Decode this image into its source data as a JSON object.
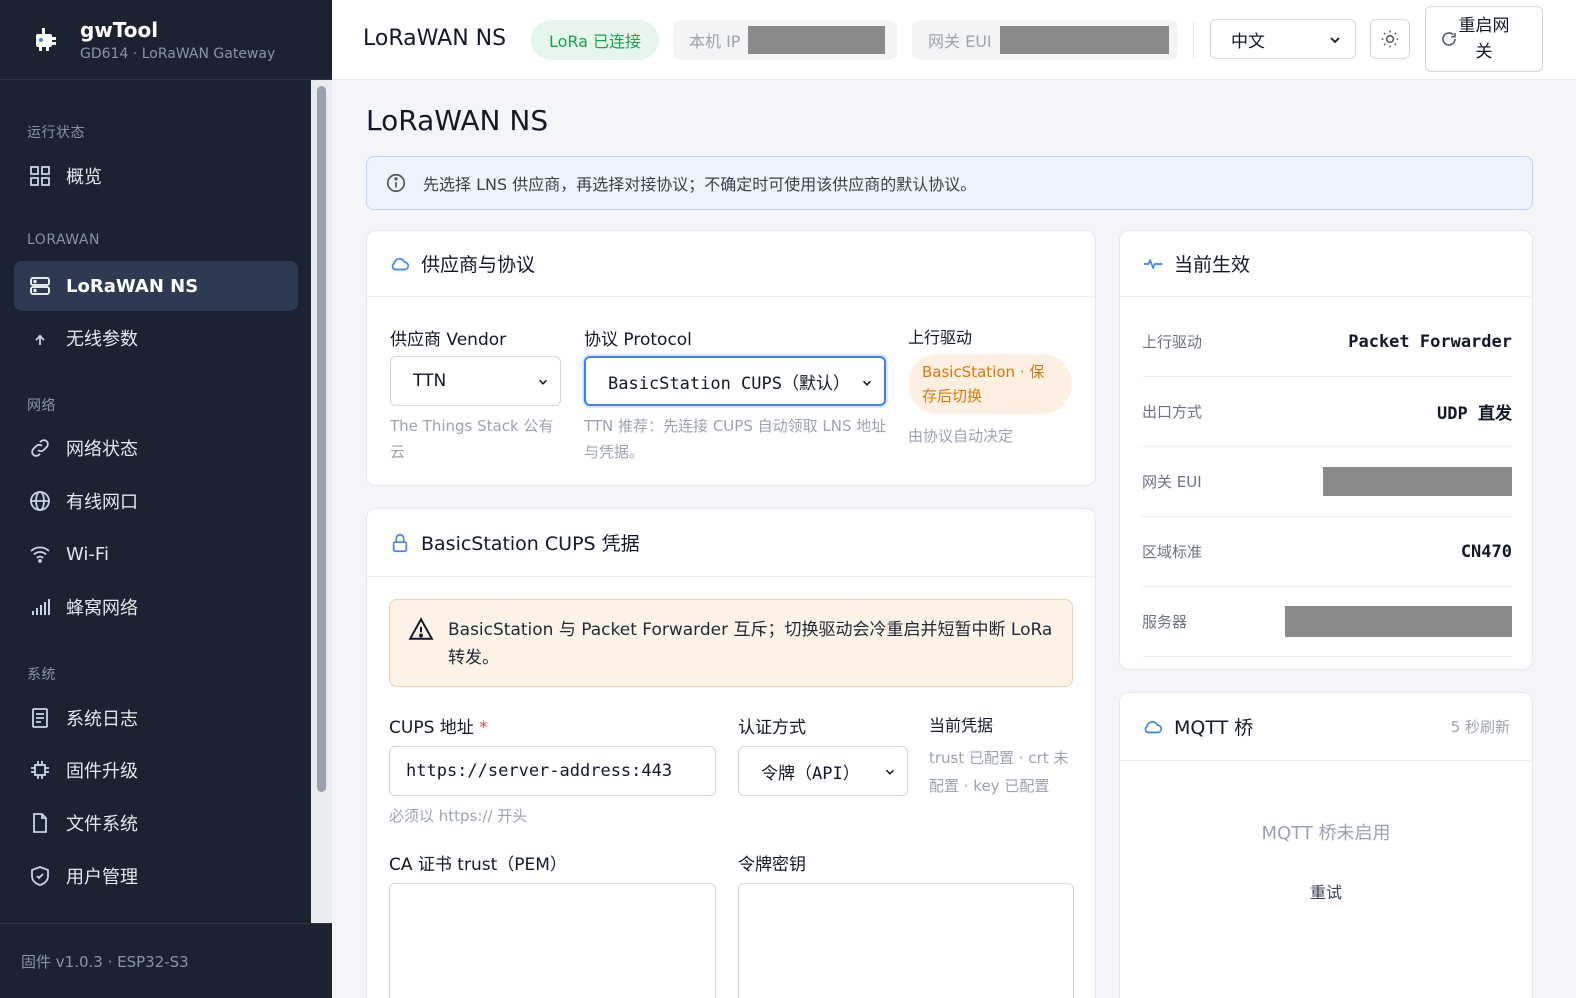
{
  "brand": {
    "title": "gwTool",
    "subtitle": "GD614 · LoRaWAN Gateway"
  },
  "sidebar": {
    "sections": [
      {
        "title": "运行状态"
      },
      {
        "title": "LORAWAN"
      },
      {
        "title": "网络"
      },
      {
        "title": "系统"
      }
    ],
    "items": [
      {
        "label": "概览",
        "icon": "grid-icon"
      },
      {
        "label": "LoRaWAN NS",
        "icon": "server-icon",
        "active": true
      },
      {
        "label": "无线参数",
        "icon": "antenna-icon"
      },
      {
        "label": "网络状态",
        "icon": "link-icon"
      },
      {
        "label": "有线网口",
        "icon": "globe-icon"
      },
      {
        "label": "Wi-Fi",
        "icon": "wifi-icon"
      },
      {
        "label": "蜂窝网络",
        "icon": "signal-icon"
      },
      {
        "label": "系统日志",
        "icon": "log-icon"
      },
      {
        "label": "固件升级",
        "icon": "chip-icon"
      },
      {
        "label": "文件系统",
        "icon": "file-icon"
      },
      {
        "label": "用户管理",
        "icon": "shield-icon"
      }
    ],
    "footer": "固件 v1.0.3 · ESP32-S3"
  },
  "header": {
    "title": "LoRaWAN NS",
    "lora_status": "LoRa 已连接",
    "local_ip_label": "本机 IP",
    "gateway_eui_label": "网关 EUI",
    "language": "中文",
    "reboot_label": "重启网关"
  },
  "main": {
    "title": "LoRaWAN NS",
    "info": "先选择 LNS 供应商，再选择对接协议；不确定时可使用该供应商的默认协议。",
    "vendor_card": {
      "title": "供应商与协议",
      "vendor_label": "供应商 Vendor",
      "vendor_value": "TTN",
      "vendor_hint": "The Things Stack 公有云",
      "protocol_label": "协议 Protocol",
      "protocol_value": "BasicStation CUPS（默认）",
      "protocol_hint": "TTN 推荐：先连接 CUPS 自动领取 LNS 地址与凭据。",
      "driver_label": "上行驱动",
      "driver_badge": "BasicStation · 保存后切换",
      "driver_hint": "由协议自动决定"
    },
    "cups_card": {
      "title": "BasicStation CUPS 凭据",
      "warning": "BasicStation 与 Packet Forwarder 互斥；切换驱动会冷重启并短暂中断 LoRa 转发。",
      "cups_label": "CUPS 地址",
      "required_mark": "*",
      "cups_value": "https://server-address:443",
      "cups_hint": "必须以 https:// 开头",
      "auth_label": "认证方式",
      "auth_value": "令牌（API）",
      "cred_label": "当前凭据",
      "cred_value": "trust 已配置 · crt 未配置 · key 已配置",
      "ca_label": "CA 证书 trust（PEM）",
      "token_label": "令牌密钥"
    },
    "effective_card": {
      "title": "当前生效",
      "rows": [
        {
          "key": "上行驱动",
          "value": "Packet Forwarder"
        },
        {
          "key": "出口方式",
          "value": "UDP 直发"
        },
        {
          "key": "网关 EUI",
          "value": ""
        },
        {
          "key": "区域标准",
          "value": "CN470"
        },
        {
          "key": "服务器",
          "value": ""
        }
      ]
    },
    "mqtt_card": {
      "title": "MQTT 桥",
      "refresh": "5 秒刷新",
      "empty": "MQTT 桥未启用",
      "retry": "重试"
    }
  },
  "colors": {
    "accent": "#3b82f6",
    "sidebar_bg": "#1b2230",
    "success": "#16a34a",
    "warning": "#d97706"
  }
}
